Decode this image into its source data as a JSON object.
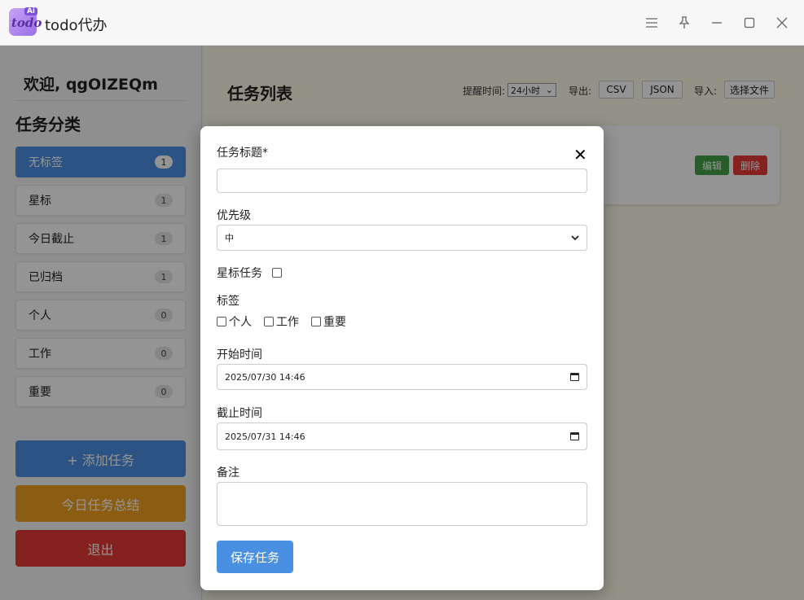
{
  "window": {
    "title": "todo代办",
    "logo_text": "todo",
    "logo_badge": "Ai"
  },
  "sidebar": {
    "welcome": "欢迎, qgOIZEQm",
    "category_heading": "任务分类",
    "categories": [
      {
        "label": "无标签",
        "count": "1"
      },
      {
        "label": "星标",
        "count": "1"
      },
      {
        "label": "今日截止",
        "count": "1"
      },
      {
        "label": "已归档",
        "count": "1"
      },
      {
        "label": "个人",
        "count": "0"
      },
      {
        "label": "工作",
        "count": "0"
      },
      {
        "label": "重要",
        "count": "0"
      }
    ],
    "add_task": "+ 添加任务",
    "daily_summary": "今日任务总结",
    "logout": "退出",
    "colors": {
      "add": "#4a90e2",
      "summary": "#f0a020",
      "logout": "#e53935"
    }
  },
  "main": {
    "list_title": "任务列表",
    "reminder_label": "提醒时间:",
    "reminder_value": "24小时",
    "export_label": "导出:",
    "export_csv": "CSV",
    "export_json": "JSON",
    "import_label": "导入:",
    "import_file": "选择文件",
    "task": {
      "edit": "编辑",
      "delete": "删除"
    }
  },
  "modal": {
    "title_label": "任务标题*",
    "title_value": "",
    "priority_label": "优先级",
    "priority_value": "中",
    "star_label": "星标任务",
    "tags_label": "标签",
    "tags": [
      "个人",
      "工作",
      "重要"
    ],
    "start_label": "开始时间",
    "start_value": "2025/07/30  14:46",
    "due_label": "截止时间",
    "due_value": "2025/07/31  14:46",
    "notes_label": "备注",
    "notes_value": "",
    "save_label": "保存任务"
  }
}
